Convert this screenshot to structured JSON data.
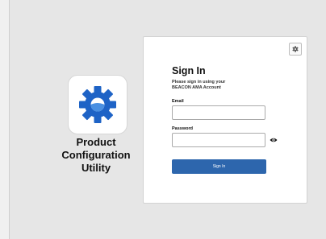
{
  "brand": {
    "name_lines": [
      "Product",
      "Configuration",
      "Utility"
    ],
    "logo_icon": "gear-icon",
    "accent": "#1e63c6"
  },
  "signin": {
    "title": "Sign In",
    "subtitle_lines": [
      "Please sign in using your",
      "BEACON AMA Account"
    ],
    "email_label": "Email",
    "email_value": "",
    "password_label": "Password",
    "password_value": "",
    "button_label": "Sign In",
    "button_color": "#2d66ad",
    "settings_icon": "gear-icon",
    "reveal_icon": "eye-icon"
  }
}
